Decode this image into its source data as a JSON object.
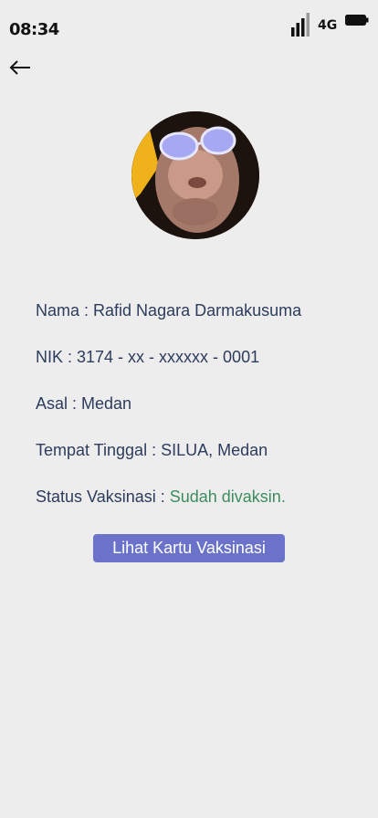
{
  "status_bar": {
    "time": "08:34",
    "network": "4G",
    "signal_icon": "signal-bars-icon",
    "battery_icon": "battery-icon"
  },
  "nav": {
    "back_icon": "arrow-left-icon"
  },
  "profile": {
    "avatar": "profile-photo",
    "name_label": "Nama : ",
    "name_value": "Rafid Nagara Darmakusuma",
    "nik_label": "NIK : ",
    "nik_value": "3174 - xx - xxxxxx - 0001",
    "origin_label": "Asal : ",
    "origin_value": "Medan",
    "residence_label": "Tempat Tinggal : ",
    "residence_value": "SILUA, Medan",
    "vaccine_label": "Status Vaksinasi : ",
    "vaccine_value": "Sudah divaksin."
  },
  "actions": {
    "view_card_label": "Lihat Kartu Vaksinasi"
  },
  "colors": {
    "background": "#ededed",
    "text": "#2d3c5c",
    "status_ok": "#3c8d5e",
    "button": "#6a72c9"
  }
}
